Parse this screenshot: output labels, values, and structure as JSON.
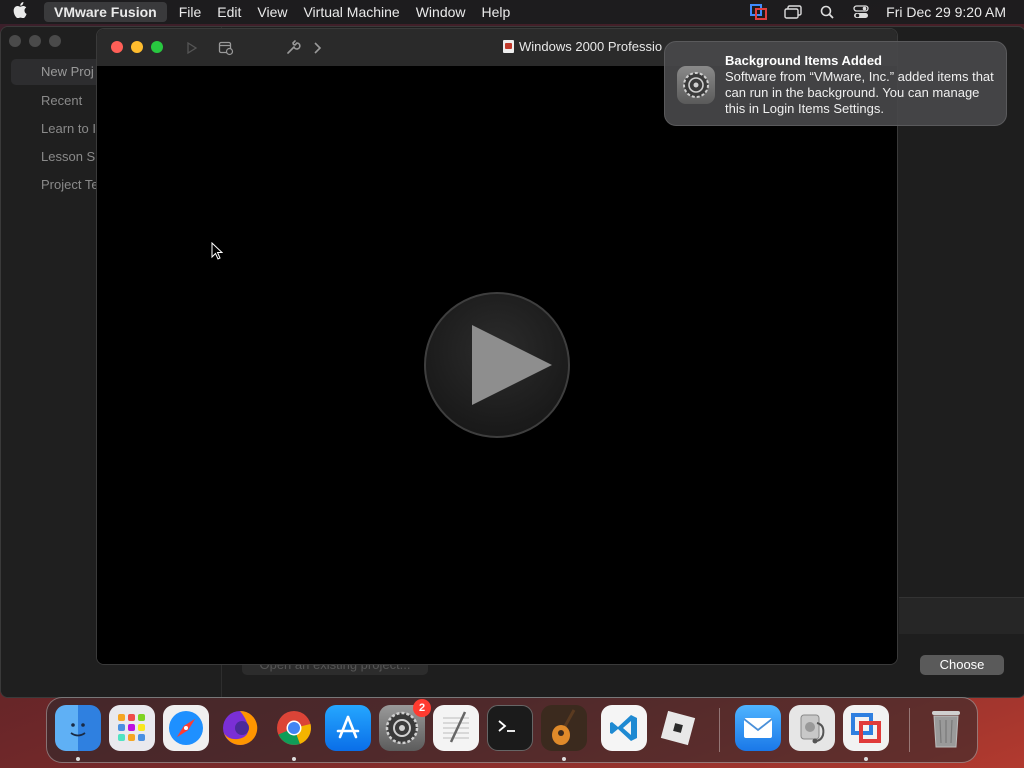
{
  "menubar": {
    "app_name": "VMware Fusion",
    "items": [
      "File",
      "Edit",
      "View",
      "Virtual Machine",
      "Window",
      "Help"
    ],
    "clock": "Fri Dec 29  9:20 AM"
  },
  "background_window": {
    "sidebar_items": [
      "New Proj",
      "Recent",
      "Learn to I",
      "Lesson S",
      "Project Te"
    ],
    "open_button": "Open an existing project...",
    "choose_button": "Choose"
  },
  "vm_window": {
    "title": "Windows 2000 Professio"
  },
  "notification": {
    "title": "Background Items Added",
    "body": "Software from “VMware, Inc.” added items that can run in the background. You can manage this in Login Items Settings."
  },
  "dock": {
    "settings_badge": "2",
    "apps": [
      "Finder",
      "Launchpad",
      "Safari",
      "Firefox",
      "Chrome",
      "App Store",
      "System Settings",
      "TextEdit",
      "Terminal",
      "GarageBand",
      "VS Code",
      "Roblox",
      "Mail",
      "Disk Utility",
      "VMware Fusion",
      "Trash"
    ]
  },
  "colors": {
    "close": "#ff5f57",
    "minimize": "#febc2e",
    "maximize": "#28c840",
    "badge": "#ff3b30"
  }
}
